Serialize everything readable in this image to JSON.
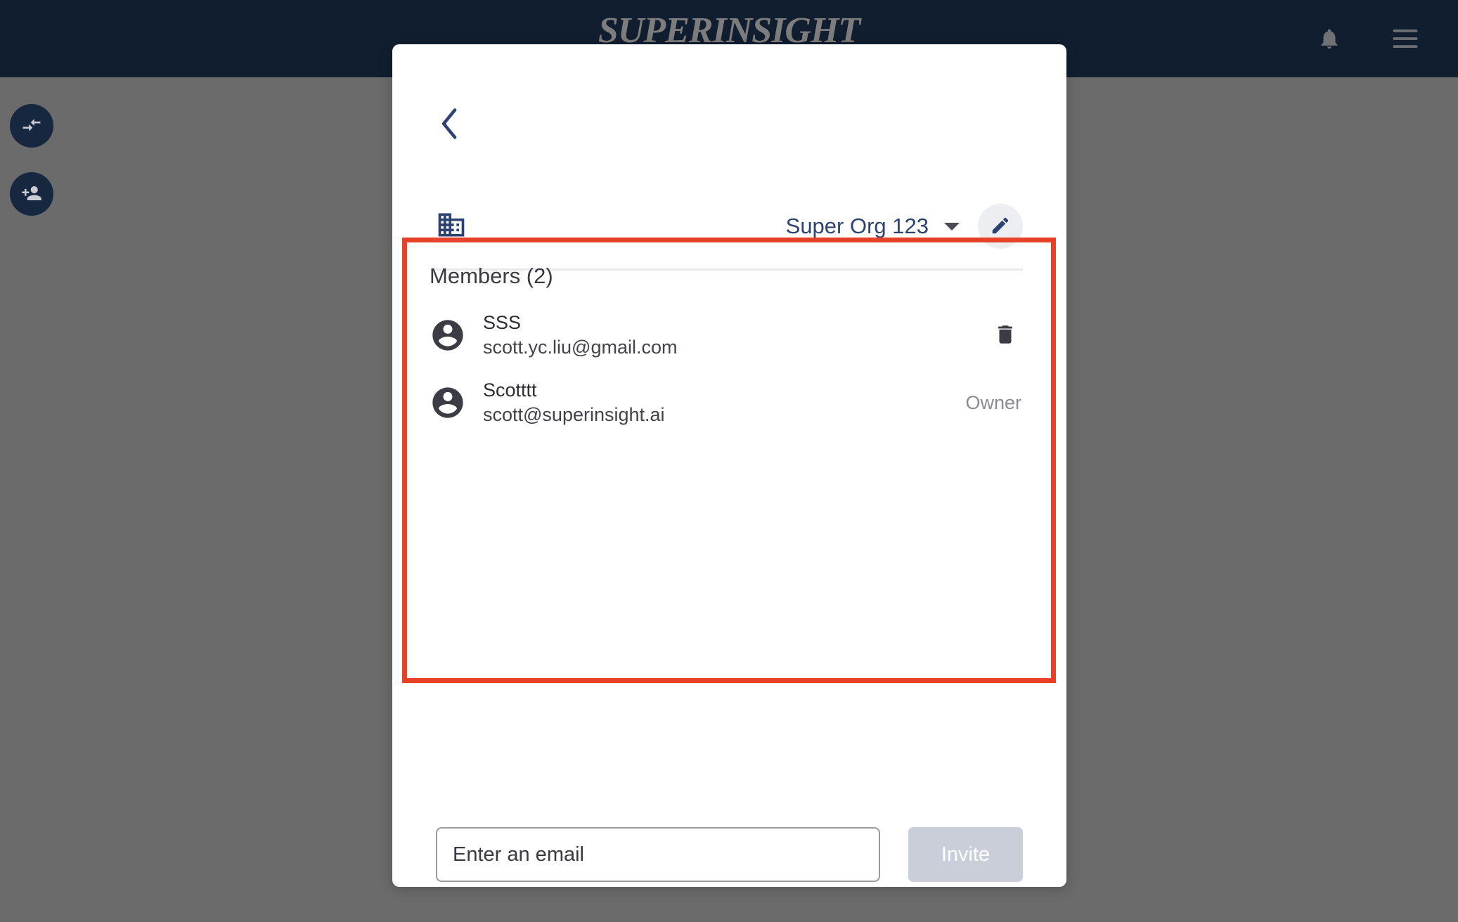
{
  "colors": {
    "topbar_bg": "#111E30",
    "overlay": "#6B6B6B",
    "accent_navy": "#2E4272",
    "highlight_red": "#E8412A",
    "modal_bg": "#FFFFFF",
    "invite_disabled": "#C9CED8"
  },
  "topbar": {
    "brand": "SUPERINSIGHT",
    "notifications_icon": "bell-icon",
    "menu_icon": "hamburger-menu-icon"
  },
  "left_rail": {
    "items": [
      {
        "icon": "compare-arrows-icon",
        "name": "swap-workspace-button"
      },
      {
        "icon": "person-add-icon",
        "name": "add-member-button"
      }
    ]
  },
  "modal": {
    "back_icon": "chevron-left-icon",
    "org": {
      "icon": "domain-building-icon",
      "name": "Super Org 123",
      "dropdown_icon": "caret-down-icon",
      "edit_icon": "pencil-edit-icon"
    },
    "members": {
      "heading": "Members (2)",
      "count": 2,
      "rows": [
        {
          "avatar_icon": "account-circle-icon",
          "name": "SSS",
          "email": "scott.yc.liu@gmail.com",
          "action": "delete",
          "action_icon": "trash-delete-icon",
          "role": ""
        },
        {
          "avatar_icon": "account-circle-icon",
          "name": "Scotttt",
          "email": "scott@superinsight.ai",
          "action": "role",
          "action_icon": "",
          "role": "Owner"
        }
      ]
    },
    "invite": {
      "placeholder": "Enter an email",
      "value": "",
      "button_label": "Invite",
      "button_enabled": false
    }
  }
}
